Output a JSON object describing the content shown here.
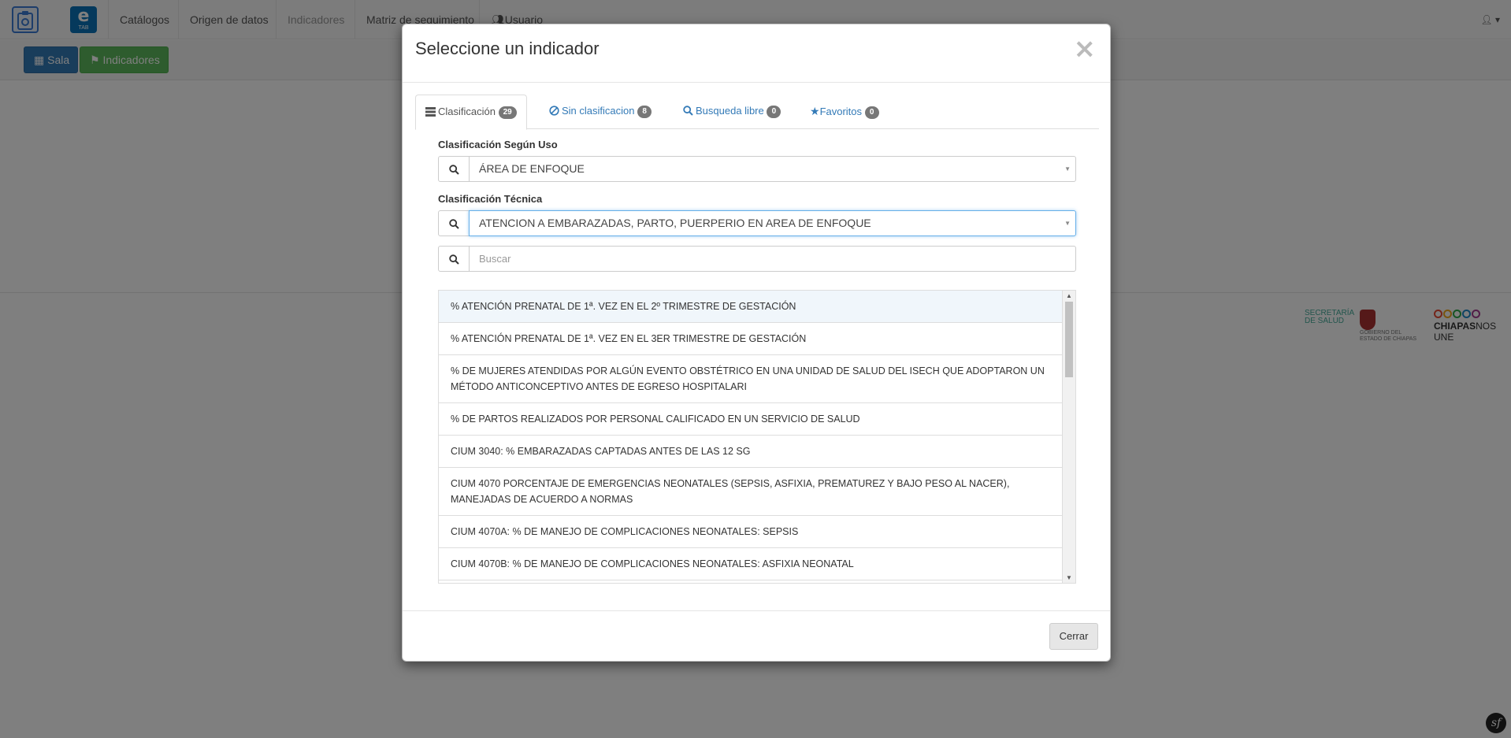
{
  "navbar": {
    "brand_letter": "e",
    "brand_sub": "TAB",
    "items": [
      {
        "label": "Catálogos"
      },
      {
        "label": "Origen de datos"
      },
      {
        "label": "Indicadores"
      },
      {
        "label": "Matriz de seguimiento"
      },
      {
        "label": "Usuario"
      }
    ]
  },
  "toolbar": {
    "sala_label": "Sala",
    "indicadores_label": "Indicadores"
  },
  "logos": {
    "salud_1": "SECRETARÍA",
    "salud_2": "DE SALUD",
    "gobierno_1": "GOBIERNO DEL",
    "gobierno_2": "ESTADO DE CHIAPAS",
    "chiapas_bold": "CHIAPAS",
    "chiapas_light": "NOS UNE"
  },
  "modal": {
    "title": "Seleccione un indicador",
    "close_symbol": "×",
    "tabs": [
      {
        "label": "Clasificación",
        "count": "29"
      },
      {
        "label": "Sin clasificacion",
        "count": "8"
      },
      {
        "label": "Busqueda libre",
        "count": "0"
      },
      {
        "label": "Favoritos",
        "count": "0"
      }
    ],
    "uso_label": "Clasificación Según Uso",
    "uso_value": "ÁREA DE ENFOQUE",
    "tecnica_label": "Clasificación Técnica",
    "tecnica_value": "ATENCION A EMBARAZADAS, PARTO, PUERPERIO EN AREA DE ENFOQUE",
    "search_placeholder": "Buscar",
    "indicators": [
      "% ATENCIÓN PRENATAL DE 1ª. VEZ EN EL 2º TRIMESTRE DE GESTACIÓN",
      "% ATENCIÓN PRENATAL DE 1ª. VEZ EN EL 3ER TRIMESTRE DE GESTACIÓN",
      "% DE MUJERES ATENDIDAS POR ALGÚN EVENTO OBSTÉTRICO EN UNA UNIDAD DE SALUD DEL ISECH QUE ADOPTARON UN MÉTODO ANTICONCEPTIVO ANTES DE EGRESO HOSPITALARI",
      "% DE PARTOS REALIZADOS POR PERSONAL CALIFICADO EN UN SERVICIO DE SALUD",
      "CIUM 3040: % EMBARAZADAS CAPTADAS ANTES DE LAS 12 SG",
      "CIUM 4070 PORCENTAJE DE EMERGENCIAS NEONATALES (SEPSIS, ASFIXIA, PREMATUREZ Y BAJO PESO AL NACER), MANEJADAS DE ACUERDO A NORMAS",
      "CIUM 4070A: % DE MANEJO DE COMPLICACIONES NEONATALES: SEPSIS",
      "CIUM 4070B: % DE MANEJO DE COMPLICACIONES NEONATALES: ASFIXIA NEONATAL"
    ],
    "footer_close_label": "Cerrar"
  },
  "colors": {
    "primary": "#337ab7",
    "success": "#5cb85c",
    "badge": "#777777",
    "backdrop": "rgba(0,0,0,0.5)"
  }
}
